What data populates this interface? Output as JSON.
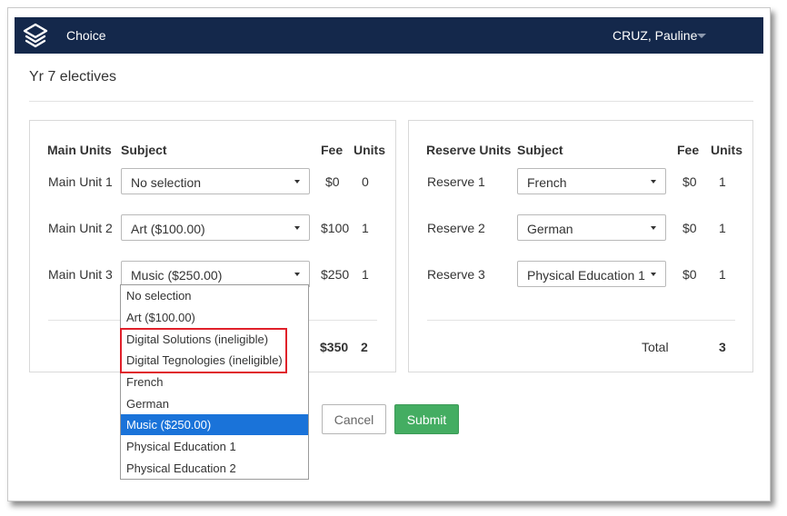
{
  "app": {
    "name": "Choice",
    "user": "CRUZ, Pauline"
  },
  "page": {
    "title": "Yr 7 electives"
  },
  "main_units": {
    "headers": {
      "unit": "Main Units",
      "subject": "Subject",
      "fee": "Fee",
      "units": "Units"
    },
    "rows": [
      {
        "label": "Main Unit 1",
        "selection": "No selection",
        "fee": "$0",
        "units": "0"
      },
      {
        "label": "Main Unit 2",
        "selection": "Art ($100.00)",
        "fee": "$100",
        "units": "1"
      },
      {
        "label": "Main Unit 3",
        "selection": "Music ($250.00)",
        "fee": "$250",
        "units": "1"
      }
    ],
    "totals": {
      "fee": "$350",
      "units": "2"
    }
  },
  "reserve_units": {
    "headers": {
      "unit": "Reserve Units",
      "subject": "Subject",
      "fee": "Fee",
      "units": "Units"
    },
    "rows": [
      {
        "label": "Reserve 1",
        "selection": "French",
        "fee": "$0",
        "units": "1"
      },
      {
        "label": "Reserve 2",
        "selection": "German",
        "fee": "$0",
        "units": "1"
      },
      {
        "label": "Reserve 3",
        "selection": "Physical Education 1",
        "fee": "$0",
        "units": "1"
      }
    ],
    "totals": {
      "label": "Total",
      "units": "3"
    }
  },
  "dropdown": {
    "options": [
      "No selection",
      "Art ($100.00)",
      "Digital Solutions (ineligible)",
      "Digital Tegnologies (ineligible)",
      "French",
      "German",
      "Music ($250.00)",
      "Physical Education 1",
      "Physical Education 2"
    ],
    "selected_index": 6
  },
  "actions": {
    "cancel_label": "Cancel",
    "submit_label": "Submit"
  },
  "colors": {
    "navbar": "#14284b",
    "highlight_border": "#e0202a",
    "selected_option": "#1a73d9",
    "submit": "#44ad62"
  },
  "icons": {
    "logo": "stacked-layers-icon",
    "user_caret": "caret-down-icon",
    "select_caret": "caret-down-icon"
  }
}
